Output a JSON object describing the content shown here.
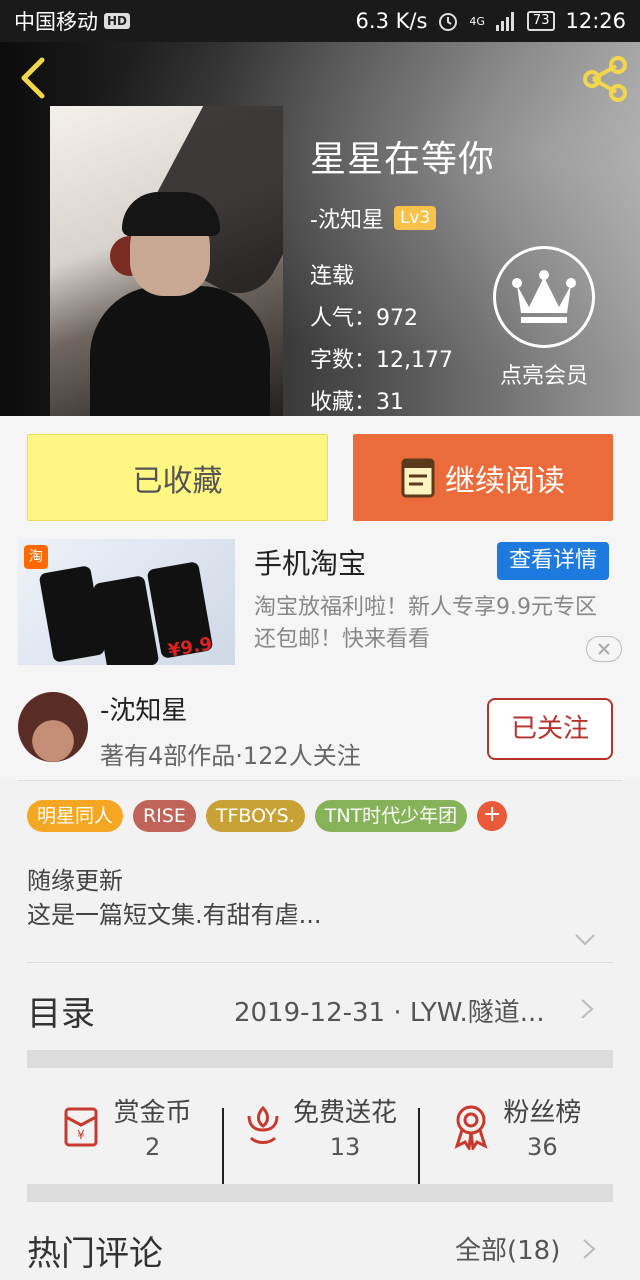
{
  "status_bar": {
    "carrier": "中国移动",
    "hd": "HD",
    "speed": "6.3 K/s",
    "network": "4G",
    "battery": "73",
    "time": "12:26"
  },
  "book": {
    "title": "星星在等你",
    "author": "-沈知星",
    "level": "Lv3",
    "status": "连载",
    "popularity": "人气：972",
    "word_count": "字数：12,177",
    "favorites": "收藏：31"
  },
  "vip": {
    "label": "点亮会员"
  },
  "actions": {
    "collected_label": "已收藏",
    "read_label": "继续阅读"
  },
  "ad": {
    "title": "手机淘宝",
    "detail_label": "查看详情",
    "description": "淘宝放福利啦！新人专享9.9元专区还包邮！快来看看",
    "image_tag": "淘",
    "image_price": "¥9.9"
  },
  "author": {
    "name": "-沈知星",
    "stats": "著有4部作品·122人关注",
    "follow_label": "已关注"
  },
  "tags": [
    {
      "label": "明星同人",
      "color": "#f5a623"
    },
    {
      "label": "RISE",
      "color": "#c0645a"
    },
    {
      "label": "TFBOYS.",
      "color": "#c9a235"
    },
    {
      "label": "TNT时代少年团",
      "color": "#86b35a"
    }
  ],
  "description": {
    "line1": "随缘更新",
    "line2": "这是一篇短文集.有甜有虐..."
  },
  "catalog": {
    "label": "目录",
    "latest": "2019-12-31 · LYW.隧道..."
  },
  "stats": {
    "reward": {
      "label": "赏金币",
      "value": "2"
    },
    "flowers": {
      "label": "免费送花",
      "value": "13"
    },
    "fans": {
      "label": "粉丝榜",
      "value": "36"
    }
  },
  "comments": {
    "label": "热门评论",
    "all_label": "全部(18)"
  },
  "colors": {
    "accent_orange": "#ec6b3a",
    "collected_yellow": "#fff683",
    "icon_red": "#c8382c",
    "ad_blue": "#1f7ae0"
  }
}
